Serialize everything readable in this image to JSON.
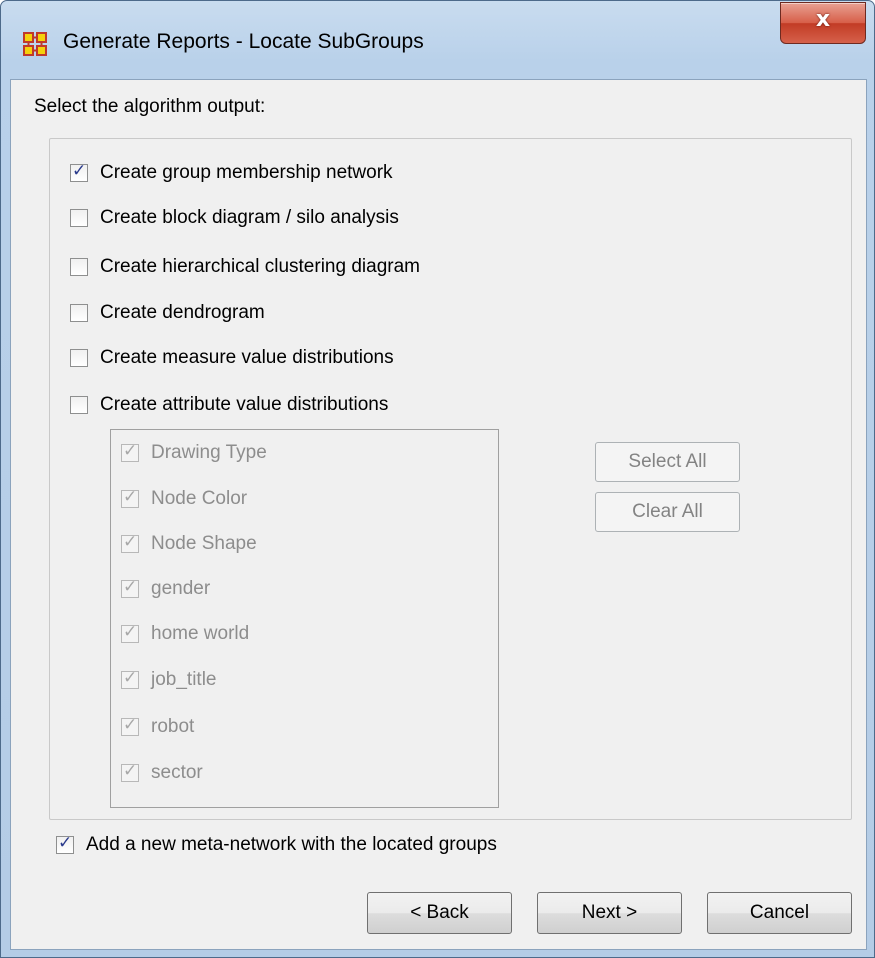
{
  "window": {
    "title": "Generate Reports - Locate SubGroups",
    "close_glyph": "x"
  },
  "prompt": "Select the algorithm output:",
  "outputs": [
    {
      "label": "Create group membership network",
      "checked": true
    },
    {
      "label": "Create block diagram / silo analysis",
      "checked": false
    },
    {
      "label": "Create hierarchical clustering diagram",
      "checked": false
    },
    {
      "label": "Create dendrogram",
      "checked": false
    },
    {
      "label": "Create measure value distributions",
      "checked": false
    },
    {
      "label": "Create attribute value distributions",
      "checked": false
    }
  ],
  "attributes": [
    {
      "label": "Drawing Type",
      "checked": true
    },
    {
      "label": "Node Color",
      "checked": true
    },
    {
      "label": "Node Shape",
      "checked": true
    },
    {
      "label": "gender",
      "checked": true
    },
    {
      "label": "home world",
      "checked": true
    },
    {
      "label": "job_title",
      "checked": true
    },
    {
      "label": "robot",
      "checked": true
    },
    {
      "label": "sector",
      "checked": true
    }
  ],
  "attr_buttons": {
    "select_all": "Select All",
    "clear_all": "Clear All"
  },
  "meta_network": {
    "label": "Add a new meta-network with the located groups",
    "checked": true
  },
  "nav": {
    "back": "< Back",
    "next": "Next >",
    "cancel": "Cancel"
  },
  "colors": {
    "title_bar": "#b9d1ea",
    "close_button": "#c9452f",
    "dialog_bg": "#f0f0f0"
  }
}
